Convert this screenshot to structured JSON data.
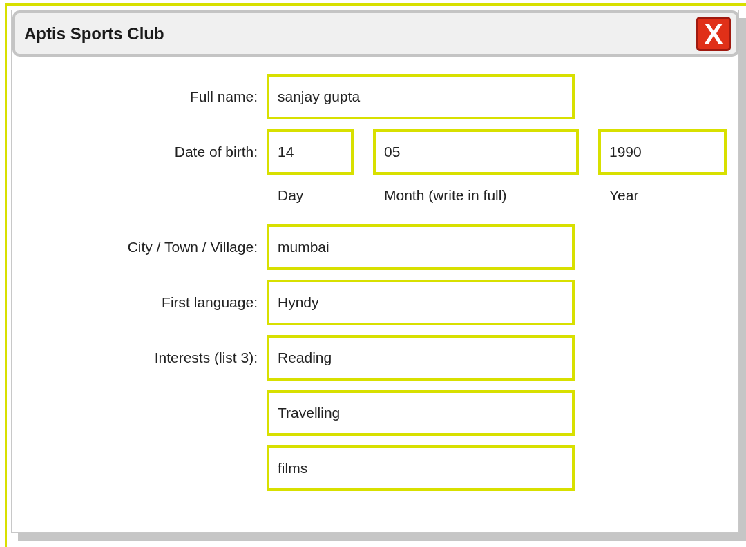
{
  "window": {
    "title": "Aptis Sports Club",
    "close_label": "X"
  },
  "form": [
    {
      "kind": "text",
      "label": "Full name:",
      "value": "sanjay gupta"
    },
    {
      "kind": "date",
      "label": "Date of birth:",
      "parts": [
        {
          "value": "14",
          "caption": "Day"
        },
        {
          "value": "05",
          "caption": "Month (write in full)"
        },
        {
          "value": "1990",
          "caption": "Year"
        }
      ]
    },
    {
      "kind": "text",
      "label": "City / Town / Village:",
      "value": "mumbai"
    },
    {
      "kind": "text",
      "label": "First language:",
      "value": "Hyndy"
    },
    {
      "kind": "list",
      "label": "Interests (list 3):",
      "values": [
        "Reading",
        "Travelling",
        "films"
      ]
    }
  ]
}
